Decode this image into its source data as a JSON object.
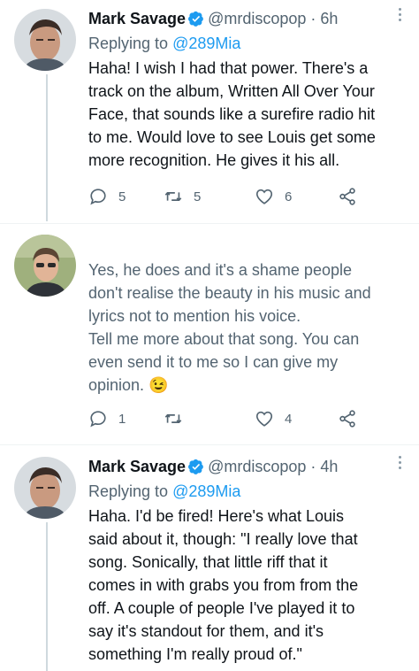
{
  "tweets": [
    {
      "author_name": "Mark Savage",
      "author_handle": "@mrdiscopop",
      "time": "· 6h",
      "reply_prefix": "Replying to ",
      "reply_to": "@289Mia",
      "lines": [
        "Haha! I wish I had that power. There's a",
        "track on the album, Written All Over Your",
        "Face, that sounds like a surefire radio hit",
        "to me. Would love to see Louis get some",
        "more recognition. He gives it his all."
      ],
      "replies": "5",
      "retweets": "5",
      "likes": "6"
    },
    {
      "lines": [
        "Yes, he does and it's a shame people",
        "don't realise the beauty in his music and",
        "lyrics not to mention his voice.",
        "Tell me more about that song. You can",
        "even send it to me so I can give my",
        "opinion. 😉"
      ],
      "replies": "1",
      "retweets": "",
      "likes": "4"
    },
    {
      "author_name": "Mark Savage",
      "author_handle": "@mrdiscopop",
      "time": "· 4h",
      "reply_prefix": "Replying to ",
      "reply_to": "@289Mia",
      "lines": [
        "Haha. I'd be fired! Here's what Louis",
        "said about it, though: \"I really love that",
        "song. Sonically, that little riff that it",
        "comes in with grabs you from from the",
        "off. A couple of people I've played it to",
        "say it's standout for them, and it's",
        "something I'm really proud of.\""
      ]
    }
  ],
  "icons": {
    "reply": "reply-icon",
    "retweet": "retweet-icon",
    "like": "heart-icon",
    "share": "share-icon",
    "verified": "verified-badge-icon",
    "more": "more-options-icon"
  },
  "colors": {
    "link": "#1d9bf0",
    "secondary_text": "#536471",
    "verified": "#1d9bf0"
  }
}
